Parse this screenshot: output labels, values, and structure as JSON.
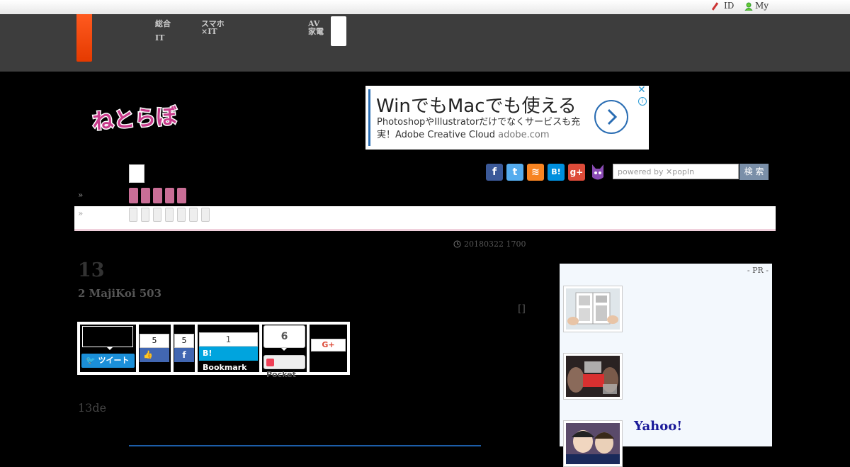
{
  "utility_bar": {
    "id_label": "ID",
    "my_label": "My"
  },
  "header": {
    "nav": [
      {
        "line1": "総合",
        "line2": "IT"
      },
      {
        "line1": "スマホ",
        "line2": "×IT"
      },
      {
        "line1": "AV",
        "line2": "家電"
      }
    ]
  },
  "logo": {
    "text": "ねとらぼ"
  },
  "ad": {
    "headline": "WinでもMacでも使える",
    "body": "PhotoshopやIllustratorだけでなくサービスも充実！Adobe Creative Cloud",
    "domain": "adobe.com",
    "close_glyph": "✕",
    "info_glyph": "i",
    "arrow_glyph": "›"
  },
  "social": [
    {
      "name": "facebook-icon",
      "glyph": "f",
      "color": "#3b5998"
    },
    {
      "name": "twitter-icon",
      "glyph": "t",
      "color": "#55acee"
    },
    {
      "name": "rss-icon",
      "glyph": "≋",
      "color": "#f78422"
    },
    {
      "name": "hatena-icon",
      "glyph": "B!",
      "color": "#008fde"
    },
    {
      "name": "google-plus-icon",
      "glyph": "g+",
      "color": "#dd4b39"
    },
    {
      "name": "mascot-icon",
      "glyph": "",
      "color": "#7a3fa0"
    }
  ],
  "search": {
    "placeholder": "powered by ✕popIn",
    "button": "検 索"
  },
  "breadcrumb_marker": "»",
  "article": {
    "datetime": "20180322 1700",
    "title": "13",
    "subtitle": "2 MajiKoi 503",
    "marker": "[]",
    "intro": "13de"
  },
  "share": {
    "tweet_label": "ツイート",
    "like_count": "5",
    "fb_share_count": "5",
    "bookmark_count": "1",
    "bookmark_label": "Bookmark",
    "pocket_count": "6",
    "pocket_label": "Pocket",
    "gplus_label": "G+"
  },
  "sidebar": {
    "pr_label": "- PR -",
    "headline_3": "Yahoo!"
  }
}
